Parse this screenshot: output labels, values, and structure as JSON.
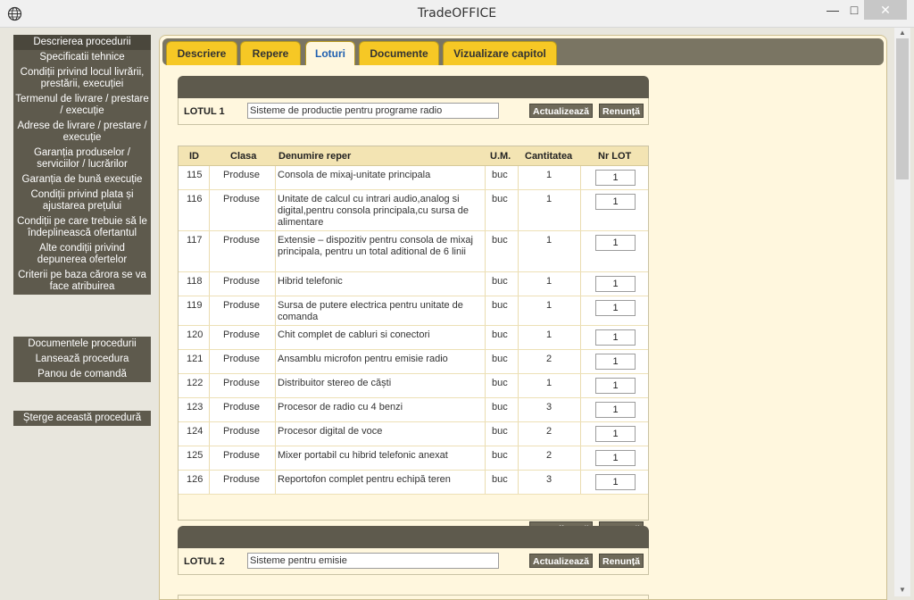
{
  "window": {
    "title": "TradeOFFICE",
    "min_icon": "minimize-icon",
    "max_icon": "maximize-icon",
    "close_icon": "close-icon"
  },
  "sidebar": {
    "group1": [
      {
        "label": "Descrierea procedurii"
      },
      {
        "label": "Specificatii tehnice"
      },
      {
        "label": "Condiții privind locul livrării, prestării, execuției"
      },
      {
        "label": "Termenul de livrare / prestare / execuție"
      },
      {
        "label": "Adrese de livrare / prestare / execuție"
      },
      {
        "label": "Garanția produselor / serviciilor / lucrărilor"
      },
      {
        "label": "Garanția de bună execuție"
      },
      {
        "label": "Condiții privind plata și ajustarea prețului"
      },
      {
        "label": "Condiții pe care trebuie să le îndeplinească ofertantul"
      },
      {
        "label": "Alte condiții privind depunerea ofertelor"
      },
      {
        "label": "Criterii pe baza cărora se va face atribuirea"
      }
    ],
    "group2": [
      {
        "label": "Documentele procedurii"
      },
      {
        "label": "Lansează procedura"
      },
      {
        "label": "Panou de comandă"
      }
    ],
    "group3": [
      {
        "label": "Șterge această procedură"
      }
    ]
  },
  "tabs": [
    {
      "label": "Descriere"
    },
    {
      "label": "Repere"
    },
    {
      "label": "Loturi"
    },
    {
      "label": "Documente"
    },
    {
      "label": "Vizualizare capitol"
    }
  ],
  "lot1": {
    "label": "LOTUL 1",
    "name": "Sisteme de productie pentru programe radio",
    "update": "Actualizează",
    "cancel": "Renunță"
  },
  "lot2": {
    "label": "LOTUL 2",
    "name": "Sisteme pentru emisie",
    "update": "Actualizează",
    "cancel": "Renunță"
  },
  "table": {
    "columns": [
      "ID",
      "Clasa",
      "Denumire reper",
      "U.M.",
      "Cantitatea",
      "Nr LOT"
    ],
    "rows": [
      {
        "id": "115",
        "clasa": "Produse",
        "denumire": "Consola de mixaj-unitate principala",
        "um": "buc",
        "cant": "1",
        "lot": "1"
      },
      {
        "id": "116",
        "clasa": "Produse",
        "denumire": "Unitate de calcul cu intrari audio,analog si digital,pentru consola principala,cu sursa de alimentare",
        "um": "buc",
        "cant": "1",
        "lot": "1"
      },
      {
        "id": "117",
        "clasa": "Produse",
        "denumire": "Extensie – dispozitiv pentru consola de mixaj principala, pentru un total aditional de 6 linii",
        "um": "buc",
        "cant": "1",
        "lot": "1"
      },
      {
        "id": "118",
        "clasa": "Produse",
        "denumire": "Hibrid telefonic",
        "um": "buc",
        "cant": "1",
        "lot": "1"
      },
      {
        "id": "119",
        "clasa": "Produse",
        "denumire": "Sursa de putere electrica pentru unitate de comanda",
        "um": "buc",
        "cant": "1",
        "lot": "1"
      },
      {
        "id": "120",
        "clasa": "Produse",
        "denumire": "Chit complet de cabluri si conectori",
        "um": "buc",
        "cant": "1",
        "lot": "1"
      },
      {
        "id": "121",
        "clasa": "Produse",
        "denumire": "Ansamblu microfon pentru emisie radio",
        "um": "buc",
        "cant": "2",
        "lot": "1"
      },
      {
        "id": "122",
        "clasa": "Produse",
        "denumire": "Distribuitor stereo de căști",
        "um": "buc",
        "cant": "1",
        "lot": "1"
      },
      {
        "id": "123",
        "clasa": "Produse",
        "denumire": "Procesor de radio cu 4 benzi",
        "um": "buc",
        "cant": "3",
        "lot": "1"
      },
      {
        "id": "124",
        "clasa": "Produse",
        "denumire": "Procesor digital de voce",
        "um": "buc",
        "cant": "2",
        "lot": "1"
      },
      {
        "id": "125",
        "clasa": "Produse",
        "denumire": "Mixer portabil cu hibrid telefonic anexat",
        "um": "buc",
        "cant": "2",
        "lot": "1"
      },
      {
        "id": "126",
        "clasa": "Produse",
        "denumire": "Reportofon complet pentru echipă teren",
        "um": "buc",
        "cant": "3",
        "lot": "1"
      }
    ],
    "update": "Actualizează",
    "cancel": "Renunță"
  }
}
